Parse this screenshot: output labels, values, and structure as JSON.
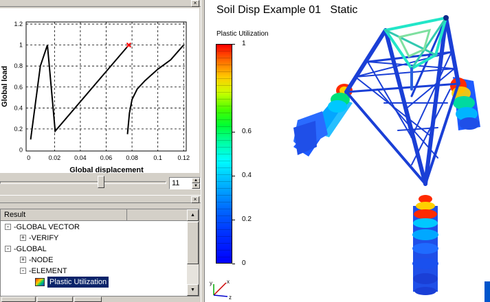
{
  "graph": {
    "y_axis_label": "Global load",
    "x_axis_label": "Global displacement",
    "y_ticks": [
      "0",
      "0.2",
      "0.4",
      "0.6",
      "0.8",
      "1",
      "1.2"
    ],
    "x_ticks": [
      "0",
      "0.02",
      "0.04",
      "0.06",
      "0.08",
      "0.1",
      "0.12"
    ]
  },
  "chart_data": {
    "type": "line",
    "xlabel": "Global displacement",
    "ylabel": "Global load",
    "xlim": [
      -0.002,
      0.122
    ],
    "ylim": [
      -0.01,
      1.22
    ],
    "grid": true,
    "series": [
      {
        "x": [
          0.0015,
          0.009,
          0.0145,
          0.0205,
          0.0775
        ],
        "y": [
          0.1,
          0.8,
          1.0,
          0.18,
          1.0
        ]
      },
      {
        "x": [
          0.0765,
          0.078,
          0.08,
          0.084,
          0.09,
          0.1,
          0.11,
          0.12
        ],
        "y": [
          0.15,
          0.35,
          0.48,
          0.58,
          0.66,
          0.77,
          0.86,
          1.0
        ]
      }
    ],
    "marker": {
      "x": 0.0775,
      "y": 1.0,
      "color": "#ff0000"
    }
  },
  "slider": {
    "step_value": "11",
    "fraction": 0.61
  },
  "tree": {
    "header": "Result",
    "rows": [
      {
        "label": "GLOBAL VECTOR",
        "toggle": "−",
        "level": 0
      },
      {
        "label": "VERIFY",
        "toggle": "+",
        "level": 1
      },
      {
        "label": "GLOBAL",
        "toggle": "−",
        "level": 0
      },
      {
        "label": "NODE",
        "toggle": "+",
        "level": 1
      },
      {
        "label": "ELEMENT",
        "toggle": "−",
        "level": 1
      },
      {
        "label": "Plastic Utilization",
        "toggle": "",
        "level": 2,
        "selected": true
      }
    ]
  },
  "viewport": {
    "title": "Soil Disp Example 01   Static",
    "legend_title": "Plastic Utilization",
    "legend_ticks": [
      {
        "value": 1.0,
        "label": "1"
      },
      {
        "value": 0.6,
        "label": "0.6"
      },
      {
        "value": 0.4,
        "label": "0.4"
      },
      {
        "value": 0.2,
        "label": "0.2"
      },
      {
        "value": 0.0,
        "label": "0"
      }
    ],
    "axis_triad": {
      "x": "x",
      "y": "y",
      "z": "z"
    }
  },
  "colors": {
    "structure": "#1a3fd6",
    "pile_hot": "#ff2a00",
    "pile_cool": "#1e5bff",
    "top_frame": "#22e6c8",
    "selection": "#0a246a"
  }
}
